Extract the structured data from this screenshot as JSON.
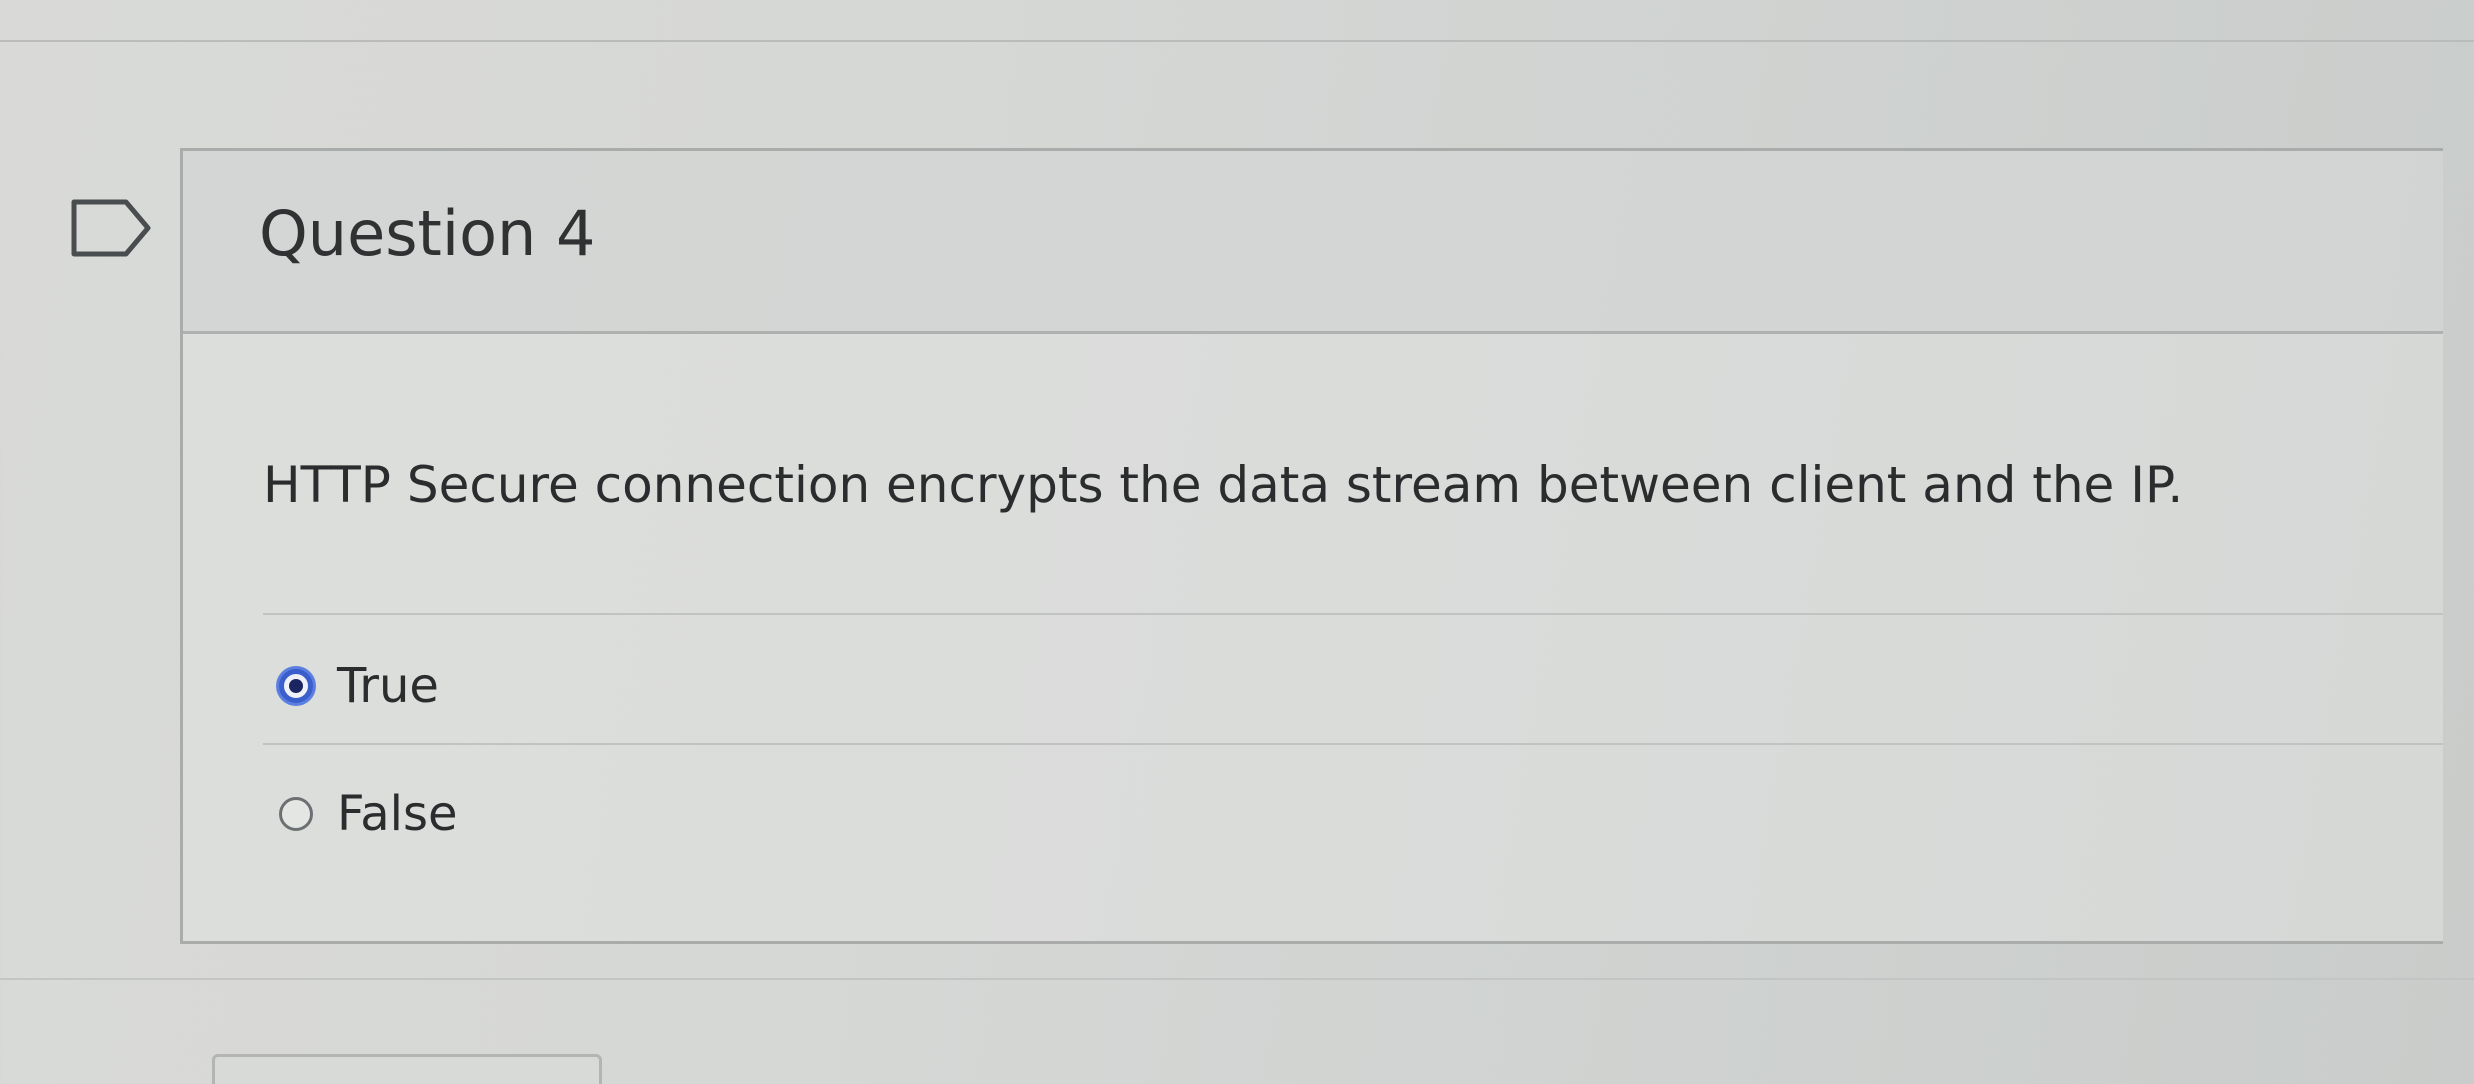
{
  "quiz": {
    "question_title": "Question 4",
    "question_text": "HTTP Secure connection encrypts the data stream between client and the IP.",
    "answers": [
      {
        "label": "True",
        "selected": true
      },
      {
        "label": "False",
        "selected": false
      }
    ]
  },
  "icons": {
    "flag": "flag-icon"
  },
  "colors": {
    "selected_radio": "#3a5fcd",
    "background": "#d6d8d6"
  }
}
